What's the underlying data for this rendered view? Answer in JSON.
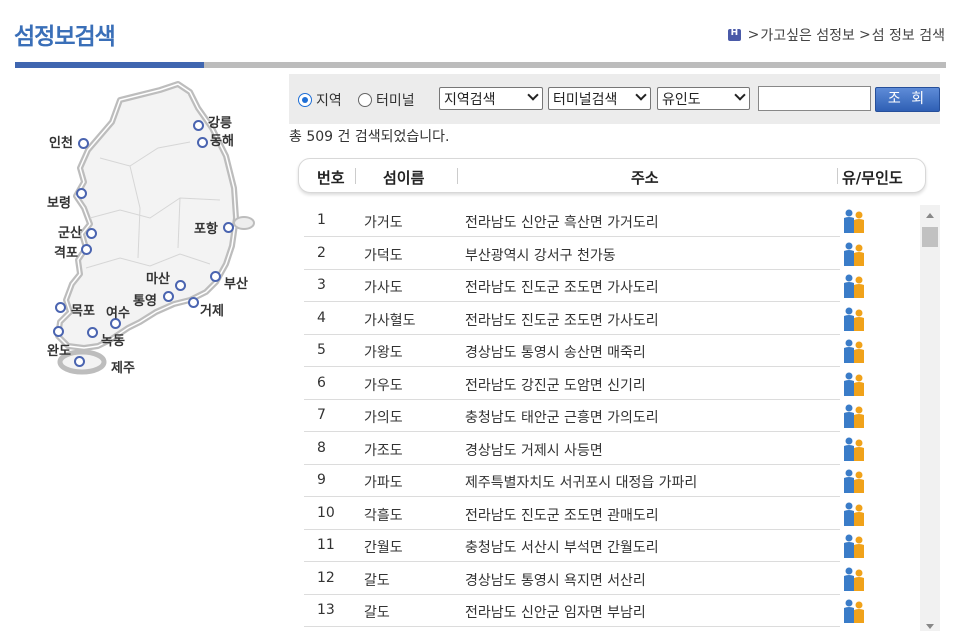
{
  "page": {
    "title": "섬정보검색"
  },
  "breadcrumb": {
    "items": [
      "가고싶은 섬정보",
      "섬 정보 검색"
    ],
    "separator": ">"
  },
  "colors": {
    "accent": "#3f66b0",
    "title": "#3a6fb8",
    "button": "#2f5fb4"
  },
  "map": {
    "cities": [
      "강릉",
      "동해",
      "인천",
      "보령",
      "포항",
      "군산",
      "격포",
      "마산",
      "부산",
      "통영",
      "거제",
      "목포",
      "여수",
      "녹동",
      "완도",
      "제주"
    ]
  },
  "search": {
    "radio_region": "지역",
    "radio_terminal": "터미널",
    "region_select": "지역검색",
    "terminal_select": "터미널검색",
    "inhabited_select": "유인도",
    "keyword_value": "",
    "button_label": "조 회"
  },
  "result": {
    "count_text": "총 509 건 검색되었습니다."
  },
  "table": {
    "headers": [
      "번호",
      "섬이름",
      "주소",
      "유/무인도"
    ],
    "rows": [
      {
        "no": "1",
        "name": "가거도",
        "address": "전라남도 신안군 흑산면 가거도리",
        "type": "inhabited-icon"
      },
      {
        "no": "2",
        "name": "가덕도",
        "address": "부산광역시 강서구 천가동",
        "type": "inhabited-icon"
      },
      {
        "no": "3",
        "name": "가사도",
        "address": "전라남도 진도군 조도면 가사도리",
        "type": "inhabited-icon"
      },
      {
        "no": "4",
        "name": "가사혈도",
        "address": "전라남도 진도군 조도면 가사도리",
        "type": "inhabited-icon"
      },
      {
        "no": "5",
        "name": "가왕도",
        "address": "경상남도 통영시 송산면 매죽리",
        "type": "inhabited-icon"
      },
      {
        "no": "6",
        "name": "가우도",
        "address": "전라남도 강진군 도암면 신기리",
        "type": "inhabited-icon"
      },
      {
        "no": "7",
        "name": "가의도",
        "address": "충청남도 태안군 근흥면 가의도리",
        "type": "inhabited-icon"
      },
      {
        "no": "8",
        "name": "가조도",
        "address": "경상남도 거제시 사등면",
        "type": "inhabited-icon"
      },
      {
        "no": "9",
        "name": "가파도",
        "address": "제주특별자치도 서귀포시 대정읍 가파리",
        "type": "inhabited-icon"
      },
      {
        "no": "10",
        "name": "각흘도",
        "address": "전라남도 진도군 조도면 관매도리",
        "type": "inhabited-icon"
      },
      {
        "no": "11",
        "name": "간월도",
        "address": "충청남도 서산시 부석면 간월도리",
        "type": "inhabited-icon"
      },
      {
        "no": "12",
        "name": "갈도",
        "address": "경상남도 통영시 욕지면 서산리",
        "type": "inhabited-icon"
      },
      {
        "no": "13",
        "name": "갈도",
        "address": "전라남도 신안군 임자면 부남리",
        "type": "inhabited-icon"
      }
    ]
  }
}
